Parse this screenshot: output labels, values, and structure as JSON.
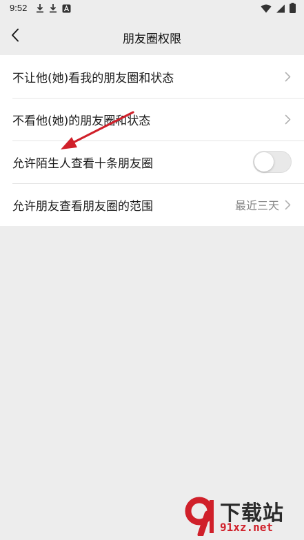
{
  "status_bar": {
    "time": "9:52",
    "left_icons": [
      "download-icon",
      "download-icon",
      "app-notification-icon"
    ],
    "right_icons": [
      "wifi-icon",
      "signal-icon",
      "battery-icon"
    ]
  },
  "header": {
    "title": "朋友圈权限",
    "back_icon": "chevron-left-icon"
  },
  "settings": {
    "items": [
      {
        "label": "不让他(她)看我的朋友圈和状态",
        "type": "link"
      },
      {
        "label": "不看他(她)的朋友圈和状态",
        "type": "link"
      },
      {
        "label": "允许陌生人查看十条朋友圈",
        "type": "toggle",
        "on": false
      },
      {
        "label": "允许朋友查看朋友圈的范围",
        "type": "link",
        "value": "最近三天"
      }
    ]
  },
  "watermark": {
    "brand": "下载站",
    "url": "91xz.net"
  },
  "colors": {
    "background": "#ededed",
    "card": "#ffffff",
    "annotation_arrow": "#d0202a",
    "watermark_red": "#d0202a"
  }
}
